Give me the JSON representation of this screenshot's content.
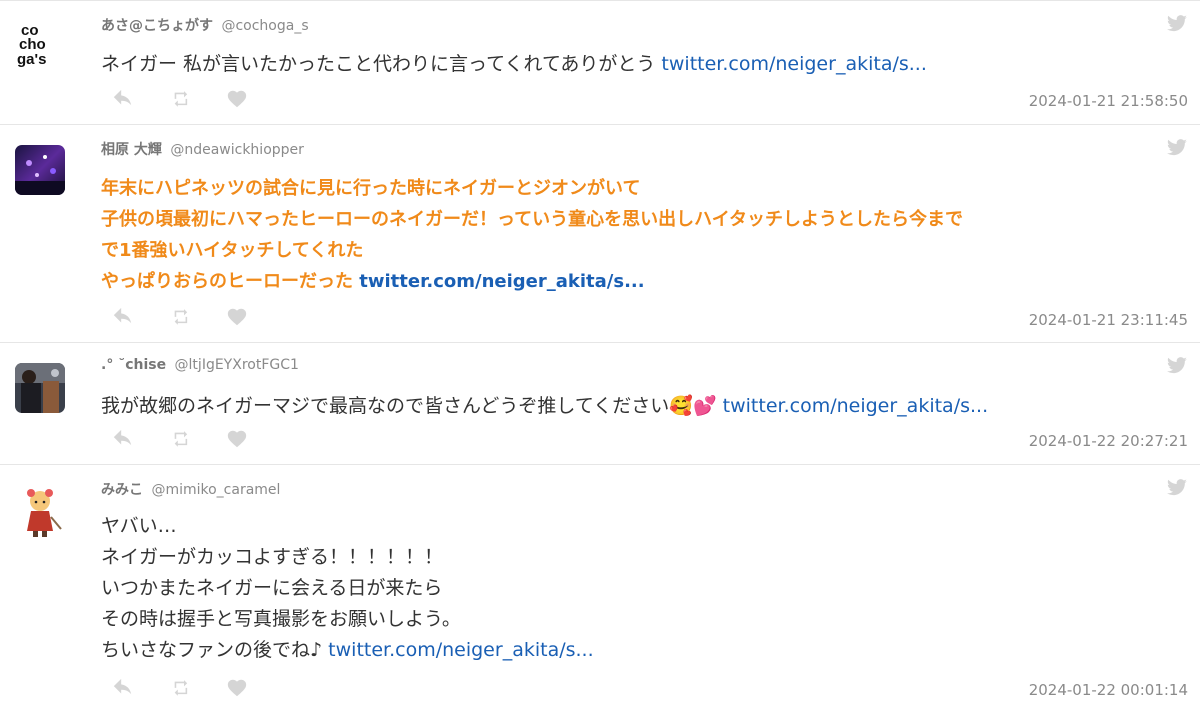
{
  "tweets": [
    {
      "name": "あさ@こちょがす",
      "handle": "@cochoga_s",
      "avatar": "cochogas-logo",
      "lines": [
        "ネイガー 私が言いたかったこと代わりに言ってくれてありがとう "
      ],
      "link": "twitter.com/neiger_akita/s...",
      "time": "2024-01-21 21:58:50",
      "highlight": false
    },
    {
      "name": "相原 大輝",
      "handle": "@ndeawickhiopper",
      "avatar": "concert-photo",
      "lines": [
        "年末にハピネッツの試合に見に行った時にネイガーとジオンがいて",
        "子供の頃最初にハマったヒーローのネイガーだ！っていう童心を思い出しハイタッチしようとしたら今まで",
        "で1番強いハイタッチしてくれた",
        "やっぱりおらのヒーローだった "
      ],
      "link": "twitter.com/neiger_akita/s...",
      "time": "2024-01-21 23:11:45",
      "highlight": true
    },
    {
      "name": ".° ˘chise",
      "handle": "@ltjIgEYXrotFGC1",
      "avatar": "person-photo",
      "lines": [
        "我が故郷のネイガーマジで最高なので皆さんどうぞ推してください🥰💕 "
      ],
      "link": "twitter.com/neiger_akita/s...",
      "time": "2024-01-22 20:27:21",
      "highlight": false
    },
    {
      "name": "みみこ",
      "handle": "@mimiko_caramel",
      "avatar": "chibi-character",
      "lines": [
        "ヤバい…",
        "ネイガーがカッコよすぎる！！！！！！",
        "いつかまたネイガーに会える日が来たら",
        "その時は握手と写真撮影をお願いしよう。",
        "ちいさなファンの後でね♪ "
      ],
      "link": "twitter.com/neiger_akita/s...",
      "time": "2024-01-22 00:01:14",
      "highlight": false
    }
  ],
  "icons": [
    "reply-icon",
    "retweet-icon",
    "like-icon",
    "twitter-bird-icon"
  ],
  "colors": {
    "link": "#1a5fb4",
    "highlight": "#f08a1a",
    "icon": "#d5d5d5",
    "divider": "#e6e6e6"
  }
}
